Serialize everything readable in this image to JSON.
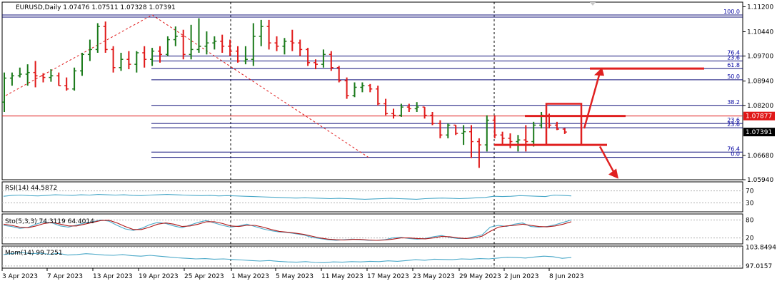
{
  "header": {
    "symbol_line": "EURUSD,Daily  1.07476 1.07511 1.07328 1.07391"
  },
  "colors": {
    "bull": "#1a7a1a",
    "bear": "#e01818",
    "fib": "#10107a",
    "hline": "#e01818",
    "annot": "#e02020",
    "osc1": "#4aa8c8",
    "osc2": "#b01818"
  },
  "chart_data": [
    {
      "type": "candlestick",
      "title": "EURUSD,Daily",
      "ohlc_readout": [
        "1.07476",
        "1.07511",
        "1.07328",
        "1.07391"
      ],
      "ylim": [
        1.0594,
        1.1134
      ],
      "y_ticks": [
        "1.11200",
        "1.10440",
        "1.09700",
        "1.08940",
        "1.08200",
        "1.06680",
        "1.05940"
      ],
      "x_ticks": [
        "3 Apr 2023",
        "7 Apr 2023",
        "13 Apr 2023",
        "19 Apr 2023",
        "25 Apr 2023",
        "1 May 2023",
        "5 May 2023",
        "11 May 2023",
        "17 May 2023",
        "23 May 2023",
        "29 May 2023",
        "2 Jun 2023",
        "8 Jun 2023"
      ],
      "candles": [
        {
          "o": 1.083,
          "h": 1.092,
          "l": 1.08,
          "c": 1.0903
        },
        {
          "o": 1.0903,
          "h": 1.092,
          "l": 1.088,
          "c": 1.091
        },
        {
          "o": 1.091,
          "h": 1.0935,
          "l": 1.0905,
          "c": 1.0915
        },
        {
          "o": 1.0915,
          "h": 1.0945,
          "l": 1.088,
          "c": 1.092
        },
        {
          "o": 1.092,
          "h": 1.0955,
          "l": 1.0875,
          "c": 1.091
        },
        {
          "o": 1.091,
          "h": 1.0918,
          "l": 1.089,
          "c": 1.0905
        },
        {
          "o": 1.0905,
          "h": 1.093,
          "l": 1.0892,
          "c": 1.091
        },
        {
          "o": 1.091,
          "h": 1.092,
          "l": 1.088,
          "c": 1.088
        },
        {
          "o": 1.088,
          "h": 1.0905,
          "l": 1.0865,
          "c": 1.087
        },
        {
          "o": 1.087,
          "h": 1.0935,
          "l": 1.0865,
          "c": 1.0925
        },
        {
          "o": 1.0925,
          "h": 1.098,
          "l": 1.091,
          "c": 1.0975
        },
        {
          "o": 1.0975,
          "h": 1.102,
          "l": 1.0955,
          "c": 1.099
        },
        {
          "o": 1.099,
          "h": 1.107,
          "l": 1.098,
          "c": 1.106
        },
        {
          "o": 1.106,
          "h": 1.1075,
          "l": 1.098,
          "c": 1.099
        },
        {
          "o": 1.099,
          "h": 1.1,
          "l": 1.092,
          "c": 1.0935
        },
        {
          "o": 1.0935,
          "h": 1.098,
          "l": 1.0925,
          "c": 1.096
        },
        {
          "o": 1.096,
          "h": 1.0985,
          "l": 1.093,
          "c": 1.0945
        },
        {
          "o": 1.0945,
          "h": 1.0985,
          "l": 1.092,
          "c": 1.098
        },
        {
          "o": 1.098,
          "h": 1.1,
          "l": 1.0935,
          "c": 1.096
        },
        {
          "o": 1.096,
          "h": 1.0995,
          "l": 1.094,
          "c": 1.0985
        },
        {
          "o": 1.0985,
          "h": 1.1,
          "l": 1.095,
          "c": 1.0975
        },
        {
          "o": 1.0975,
          "h": 1.103,
          "l": 1.097,
          "c": 1.102
        },
        {
          "o": 1.102,
          "h": 1.106,
          "l": 1.1,
          "c": 1.103
        },
        {
          "o": 1.103,
          "h": 1.105,
          "l": 1.096,
          "c": 1.0975
        },
        {
          "o": 1.0975,
          "h": 1.1065,
          "l": 1.096,
          "c": 1.099
        },
        {
          "o": 1.099,
          "h": 1.1085,
          "l": 1.098,
          "c": 1.1
        },
        {
          "o": 1.1,
          "h": 1.1045,
          "l": 1.0975,
          "c": 1.101
        },
        {
          "o": 1.101,
          "h": 1.103,
          "l": 1.099,
          "c": 1.1015
        },
        {
          "o": 1.1015,
          "h": 1.1035,
          "l": 1.098,
          "c": 1.1
        },
        {
          "o": 1.1,
          "h": 1.102,
          "l": 1.097,
          "c": 1.0985
        },
        {
          "o": 1.0985,
          "h": 1.1,
          "l": 1.095,
          "c": 1.0955
        },
        {
          "o": 1.0955,
          "h": 1.1,
          "l": 1.0945,
          "c": 1.096
        },
        {
          "o": 1.096,
          "h": 1.107,
          "l": 1.094,
          "c": 1.103
        },
        {
          "o": 1.103,
          "h": 1.108,
          "l": 1.1,
          "c": 1.106
        },
        {
          "o": 1.106,
          "h": 1.108,
          "l": 1.099,
          "c": 1.101
        },
        {
          "o": 1.101,
          "h": 1.103,
          "l": 1.0985,
          "c": 1.1
        },
        {
          "o": 1.1,
          "h": 1.1025,
          "l": 1.0975,
          "c": 1.1015
        },
        {
          "o": 1.1015,
          "h": 1.105,
          "l": 1.0985,
          "c": 1.101
        },
        {
          "o": 1.101,
          "h": 1.102,
          "l": 1.097,
          "c": 1.099
        },
        {
          "o": 1.099,
          "h": 1.0995,
          "l": 1.094,
          "c": 1.095
        },
        {
          "o": 1.095,
          "h": 1.096,
          "l": 1.093,
          "c": 1.0945
        },
        {
          "o": 1.0945,
          "h": 1.099,
          "l": 1.0935,
          "c": 1.0975
        },
        {
          "o": 1.0975,
          "h": 1.0985,
          "l": 1.0925,
          "c": 1.0935
        },
        {
          "o": 1.0935,
          "h": 1.094,
          "l": 1.089,
          "c": 1.0895
        },
        {
          "o": 1.0895,
          "h": 1.0905,
          "l": 1.084,
          "c": 1.085
        },
        {
          "o": 1.085,
          "h": 1.089,
          "l": 1.0845,
          "c": 1.0875
        },
        {
          "o": 1.0875,
          "h": 1.089,
          "l": 1.086,
          "c": 1.088
        },
        {
          "o": 1.088,
          "h": 1.0885,
          "l": 1.086,
          "c": 1.087
        },
        {
          "o": 1.087,
          "h": 1.088,
          "l": 1.082,
          "c": 1.0825
        },
        {
          "o": 1.0825,
          "h": 1.084,
          "l": 1.079,
          "c": 1.0795
        },
        {
          "o": 1.0795,
          "h": 1.081,
          "l": 1.078,
          "c": 1.079
        },
        {
          "o": 1.079,
          "h": 1.0825,
          "l": 1.0785,
          "c": 1.0815
        },
        {
          "o": 1.0815,
          "h": 1.0825,
          "l": 1.08,
          "c": 1.081
        },
        {
          "o": 1.081,
          "h": 1.083,
          "l": 1.08,
          "c": 1.0815
        },
        {
          "o": 1.0815,
          "h": 1.0815,
          "l": 1.078,
          "c": 1.079
        },
        {
          "o": 1.079,
          "h": 1.08,
          "l": 1.076,
          "c": 1.0765
        },
        {
          "o": 1.0765,
          "h": 1.0775,
          "l": 1.072,
          "c": 1.073
        },
        {
          "o": 1.073,
          "h": 1.0765,
          "l": 1.072,
          "c": 1.076
        },
        {
          "o": 1.076,
          "h": 1.076,
          "l": 1.073,
          "c": 1.0735
        },
        {
          "o": 1.0735,
          "h": 1.076,
          "l": 1.07,
          "c": 1.074
        },
        {
          "o": 1.074,
          "h": 1.076,
          "l": 1.066,
          "c": 1.071
        },
        {
          "o": 1.071,
          "h": 1.072,
          "l": 1.063,
          "c": 1.07
        },
        {
          "o": 1.07,
          "h": 1.079,
          "l": 1.068,
          "c": 1.0775
        },
        {
          "o": 1.0775,
          "h": 1.079,
          "l": 1.072,
          "c": 1.073
        },
        {
          "o": 1.073,
          "h": 1.074,
          "l": 1.07,
          "c": 1.072
        },
        {
          "o": 1.072,
          "h": 1.0735,
          "l": 1.069,
          "c": 1.071
        },
        {
          "o": 1.071,
          "h": 1.073,
          "l": 1.068,
          "c": 1.0715
        },
        {
          "o": 1.0715,
          "h": 1.076,
          "l": 1.068,
          "c": 1.071
        },
        {
          "o": 1.071,
          "h": 1.077,
          "l": 1.0695,
          "c": 1.076
        },
        {
          "o": 1.076,
          "h": 1.08,
          "l": 1.075,
          "c": 1.079
        },
        {
          "o": 1.079,
          "h": 1.0795,
          "l": 1.075,
          "c": 1.076
        },
        {
          "o": 1.076,
          "h": 1.077,
          "l": 1.0745,
          "c": 1.0748
        },
        {
          "o": 1.0748,
          "h": 1.0751,
          "l": 1.0733,
          "c": 1.0739
        }
      ],
      "fib_levels": [
        {
          "label": "100.0",
          "price": 1.1095
        },
        {
          "label": "76.4",
          "price": 1.097
        },
        {
          "label": "23.6",
          "price": 1.0955
        },
        {
          "label": "61.8",
          "price": 1.0932
        },
        {
          "label": "50.0",
          "price": 1.0898
        },
        {
          "label": "38.2",
          "price": 1.082
        },
        {
          "label": "23.6",
          "price": 1.0765
        },
        {
          "label": "23.6",
          "price": 1.0752
        },
        {
          "label": "76.4",
          "price": 1.0678
        },
        {
          "label": "0.0",
          "price": 1.0662
        }
      ],
      "price_markers": [
        {
          "label": "1.07877",
          "price": 1.07877,
          "bg": "#e01818",
          "fg": "#ffffff"
        },
        {
          "label": "1.07391",
          "price": 1.07391,
          "bg": "#000000",
          "fg": "#ffffff"
        }
      ]
    },
    {
      "type": "line",
      "title": "RSI(14) 44.5872",
      "ylim": [
        0,
        100
      ],
      "y_ticks": [
        {
          "label": "70",
          "value": 70
        },
        {
          "label": "30",
          "value": 30
        }
      ],
      "series": [
        {
          "values": [
            52,
            55,
            56,
            54,
            53,
            55,
            57,
            56,
            55,
            57,
            56,
            58,
            57,
            56,
            57,
            55,
            54,
            56,
            57,
            58,
            57,
            56,
            55,
            54,
            55,
            53,
            54,
            53,
            52,
            51,
            50,
            49,
            48,
            47,
            46,
            47,
            46,
            45,
            44,
            45,
            44,
            43,
            42,
            43,
            44,
            45,
            44,
            43,
            42,
            44,
            45,
            46,
            45,
            44,
            45,
            47,
            48,
            52,
            51,
            52,
            54,
            53,
            52,
            51,
            56,
            55,
            53
          ]
        }
      ]
    },
    {
      "type": "line",
      "title": "Sto(5,3,3) 74.3119 64.4014",
      "ylim": [
        0,
        100
      ],
      "y_ticks": [
        {
          "label": "80",
          "value": 80
        },
        {
          "label": "20",
          "value": 20
        }
      ],
      "series": [
        {
          "values": [
            62,
            58,
            52,
            55,
            66,
            74,
            70,
            60,
            56,
            63,
            70,
            74,
            80,
            76,
            62,
            50,
            45,
            52,
            64,
            72,
            68,
            60,
            54,
            63,
            72,
            78,
            70,
            62,
            56,
            60,
            66,
            58,
            50,
            44,
            40,
            38,
            34,
            30,
            22,
            18,
            14,
            12,
            14,
            16,
            14,
            12,
            12,
            14,
            20,
            22,
            18,
            16,
            18,
            24,
            28,
            22,
            18,
            18,
            24,
            30,
            56,
            62,
            58,
            66,
            70,
            58,
            56,
            58,
            64,
            72,
            80
          ]
        },
        {
          "values": [
            66,
            62,
            56,
            54,
            60,
            68,
            72,
            66,
            60,
            60,
            66,
            72,
            78,
            79,
            70,
            58,
            48,
            48,
            56,
            66,
            70,
            66,
            58,
            60,
            66,
            74,
            74,
            68,
            60,
            58,
            62,
            62,
            56,
            48,
            42,
            39,
            36,
            32,
            26,
            20,
            16,
            14,
            13,
            15,
            15,
            13,
            12,
            13,
            16,
            20,
            20,
            18,
            17,
            20,
            25,
            24,
            20,
            18,
            20,
            26,
            42,
            56,
            60,
            62,
            66,
            62,
            58,
            57,
            60,
            66,
            74
          ]
        }
      ]
    },
    {
      "type": "line",
      "title": "Mom(14) 99.7251",
      "y_ticks": [
        {
          "label": "103.8494",
          "value": 103.8494
        },
        {
          "label": "97.0157",
          "value": 97.0157
        }
      ],
      "ylim": [
        96.2,
        104.3
      ],
      "series": [
        {
          "values": [
            101.2,
            101.6,
            101.9,
            101.5,
            101.7,
            101.3,
            101.6,
            101.0,
            101.2,
            101.5,
            101.3,
            101.0,
            100.9,
            101.2,
            100.8,
            100.6,
            100.9,
            100.6,
            100.3,
            100.0,
            99.8,
            99.6,
            99.7,
            99.5,
            99.6,
            99.4,
            99.2,
            99.0,
            98.8,
            99.0,
            98.7,
            98.5,
            98.4,
            98.6,
            98.3,
            98.2,
            98.5,
            98.4,
            98.6,
            98.5,
            98.7,
            98.6,
            98.9,
            98.7,
            99.0,
            99.3,
            99.1,
            99.5,
            99.4,
            99.3,
            99.6,
            99.5,
            99.7,
            99.6,
            99.9,
            100.2,
            100.1,
            99.9,
            100.3,
            100.6,
            100.4,
            99.8,
            100.1
          ]
        }
      ]
    }
  ]
}
